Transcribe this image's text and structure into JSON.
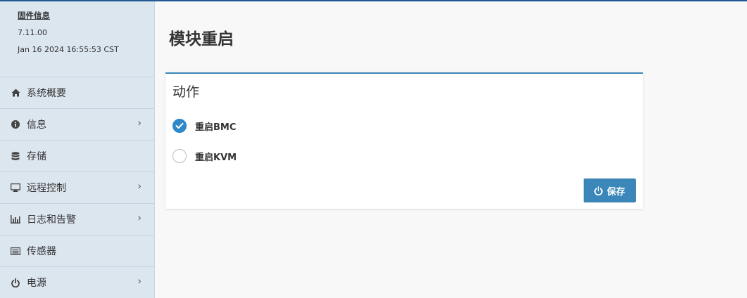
{
  "sidebar": {
    "firmware": {
      "title": "固件信息",
      "version": "7.11.00",
      "build_date": "Jan 16 2024 16:55:53 CST"
    },
    "items": [
      {
        "label": "系统概要",
        "icon": "home-icon",
        "has_submenu": false
      },
      {
        "label": "信息",
        "icon": "info-icon",
        "has_submenu": true
      },
      {
        "label": "存储",
        "icon": "database-icon",
        "has_submenu": false
      },
      {
        "label": "远程控制",
        "icon": "desktop-icon",
        "has_submenu": true
      },
      {
        "label": "日志和告警",
        "icon": "bar-chart-icon",
        "has_submenu": true
      },
      {
        "label": "传感器",
        "icon": "list-icon",
        "has_submenu": false
      },
      {
        "label": "电源",
        "icon": "power-icon",
        "has_submenu": true
      }
    ],
    "chevron": "›"
  },
  "main": {
    "title": "模块重启",
    "panel": {
      "title": "动作",
      "options": [
        {
          "label": "重启BMC",
          "checked": true
        },
        {
          "label": "重启KVM",
          "checked": false
        }
      ],
      "save_label": "保存"
    }
  },
  "colors": {
    "accent": "#2d87c8",
    "button": "#3b87b9",
    "sidebar_bg": "#dce6ef",
    "top_bar": "#1f5a96"
  }
}
